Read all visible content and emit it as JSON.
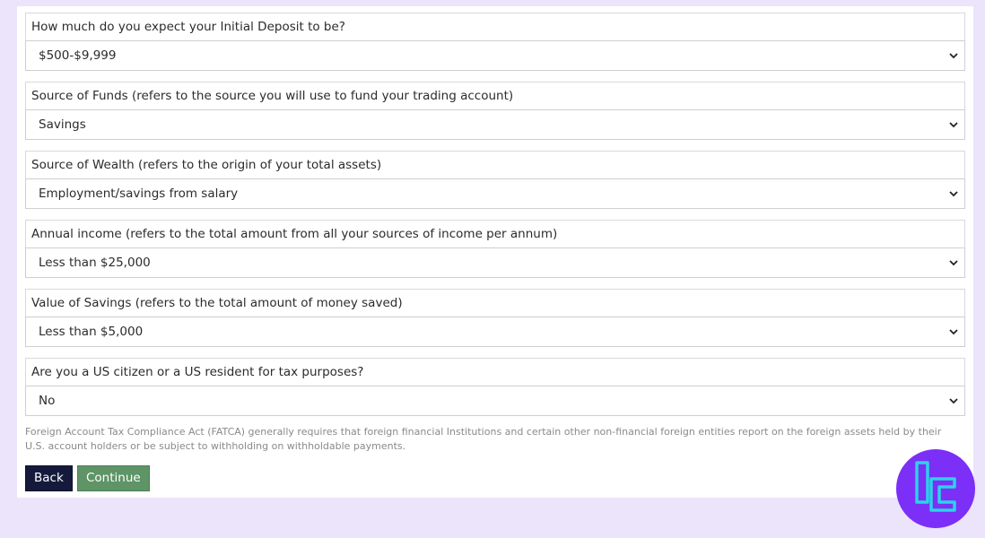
{
  "questions": [
    {
      "label": "How much do you expect your Initial Deposit to be?",
      "value": "$500-$9,999"
    },
    {
      "label": "Source of Funds (refers to the source you will use to fund your trading account)",
      "value": "Savings"
    },
    {
      "label": "Source of Wealth (refers to the origin of your total assets)",
      "value": "Employment/savings from salary"
    },
    {
      "label": "Annual income (refers to the total amount from all your sources of income per annum)",
      "value": "Less than $25,000"
    },
    {
      "label": "Value of Savings (refers to the total amount of money saved)",
      "value": "Less than $5,000"
    },
    {
      "label": "Are you a US citizen or a US resident for tax purposes?",
      "value": "No"
    }
  ],
  "fatca_note": "Foreign Account Tax Compliance Act (FATCA) generally requires that foreign financial Institutions and certain other non-financial foreign entities report on the foreign assets held by their U.S. account holders or be subject to withholding on withholdable payments.",
  "buttons": {
    "back": "Back",
    "continue": "Continue"
  },
  "colors": {
    "page_background": "#ece4fb",
    "back_button": "#151a3d",
    "continue_button": "#5e9466",
    "logo_fill": "#7b2ff7",
    "logo_stroke": "#2ad4e8"
  },
  "icons": {
    "select_arrow": "chevron-down-icon",
    "brand": "tc-logo-icon"
  }
}
